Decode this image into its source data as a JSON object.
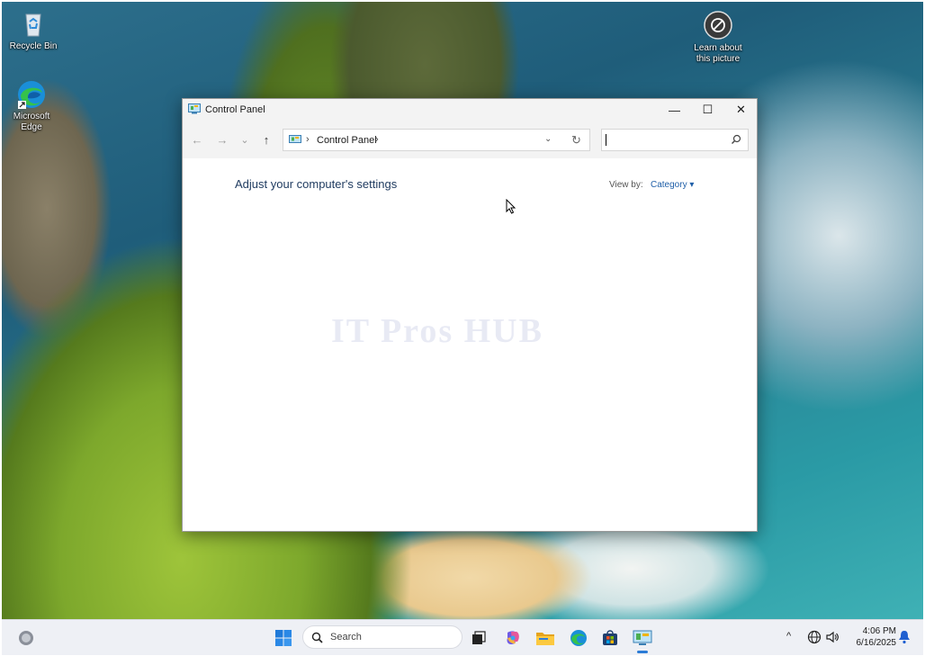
{
  "desktop": {
    "icons": [
      {
        "label": "Recycle Bin",
        "icon": "recycle-bin-icon"
      },
      {
        "label": "Microsoft Edge",
        "icon": "edge-icon"
      },
      {
        "label": "Learn about this picture",
        "icon": "camera-icon"
      }
    ]
  },
  "window": {
    "title": "Control Panel",
    "controls": {
      "minimize": "—",
      "maximize": "☐",
      "close": "✕"
    },
    "nav": {
      "back": "←",
      "forward": "→",
      "recent": "⌄",
      "up": "↑"
    },
    "address": {
      "separator": "›",
      "crumb": "Control Panel",
      "trailing": "›",
      "dropdown": "⌄",
      "refresh": "↻"
    },
    "search": {
      "value": "",
      "placeholder": ""
    },
    "heading": "Adjust your computer's settings",
    "view_by": {
      "label": "View by:",
      "value": "Category ▾"
    },
    "watermark": "IT Pros HUB"
  },
  "taskbar": {
    "search_label": "Search",
    "apps": [
      "start-icon",
      "task-view-icon",
      "copilot-icon",
      "file-explorer-icon",
      "edge-icon",
      "store-icon",
      "control-panel-icon"
    ],
    "tray": {
      "chevron": "^"
    },
    "time": "4:06 PM",
    "date": "6/16/2025"
  },
  "colors": {
    "accent": "#2b7bd6",
    "link": "#1f5fa8",
    "heading": "#1e3a5f",
    "titlebar": "#f3f3f3"
  }
}
